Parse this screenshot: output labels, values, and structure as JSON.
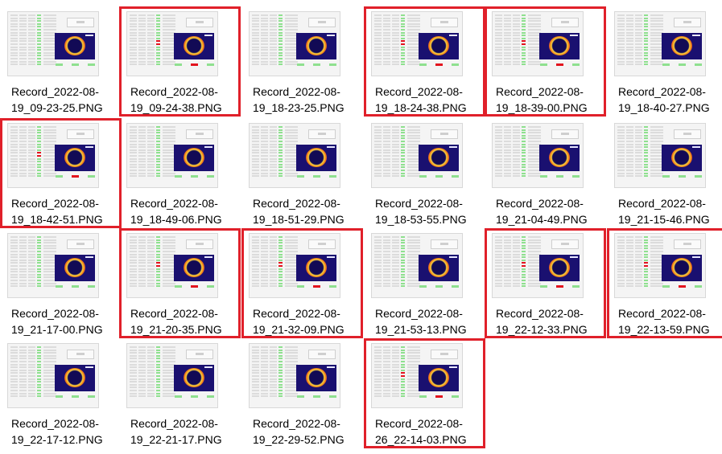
{
  "files": [
    {
      "line1": "Record_2022-08-",
      "line2": "19_09-23-25.PNG",
      "selected": false,
      "alert": false
    },
    {
      "line1": "Record_2022-08-",
      "line2": "19_09-24-38.PNG",
      "selected": true,
      "alert": true
    },
    {
      "line1": "Record_2022-08-",
      "line2": "19_18-23-25.PNG",
      "selected": false,
      "alert": false
    },
    {
      "line1": "Record_2022-08-",
      "line2": "19_18-24-38.PNG",
      "selected": true,
      "alert": true
    },
    {
      "line1": "Record_2022-08-",
      "line2": "19_18-39-00.PNG",
      "selected": true,
      "alert": true
    },
    {
      "line1": "Record_2022-08-",
      "line2": "19_18-40-27.PNG",
      "selected": false,
      "alert": false
    },
    {
      "line1": "Record_2022-08-",
      "line2": "19_18-42-51.PNG",
      "selected": true,
      "alert": true
    },
    {
      "line1": "Record_2022-08-",
      "line2": "19_18-49-06.PNG",
      "selected": false,
      "alert": false
    },
    {
      "line1": "Record_2022-08-",
      "line2": "19_18-51-29.PNG",
      "selected": false,
      "alert": false
    },
    {
      "line1": "Record_2022-08-",
      "line2": "19_18-53-55.PNG",
      "selected": false,
      "alert": false
    },
    {
      "line1": "Record_2022-08-",
      "line2": "19_21-04-49.PNG",
      "selected": false,
      "alert": false
    },
    {
      "line1": "Record_2022-08-",
      "line2": "19_21-15-46.PNG",
      "selected": false,
      "alert": false
    },
    {
      "line1": "Record_2022-08-",
      "line2": "19_21-17-00.PNG",
      "selected": false,
      "alert": false
    },
    {
      "line1": "Record_2022-08-",
      "line2": "19_21-20-35.PNG",
      "selected": true,
      "alert": true
    },
    {
      "line1": "Record_2022-08-",
      "line2": "19_21-32-09.PNG",
      "selected": true,
      "alert": true
    },
    {
      "line1": "Record_2022-08-",
      "line2": "19_21-53-13.PNG",
      "selected": false,
      "alert": false
    },
    {
      "line1": "Record_2022-08-",
      "line2": "19_22-12-33.PNG",
      "selected": true,
      "alert": true
    },
    {
      "line1": "Record_2022-08-",
      "line2": "19_22-13-59.PNG",
      "selected": true,
      "alert": true
    },
    {
      "line1": "Record_2022-08-",
      "line2": "19_22-17-12.PNG",
      "selected": false,
      "alert": false
    },
    {
      "line1": "Record_2022-08-",
      "line2": "19_22-21-17.PNG",
      "selected": false,
      "alert": false
    },
    {
      "line1": "Record_2022-08-",
      "line2": "19_22-29-52.PNG",
      "selected": false,
      "alert": false
    },
    {
      "line1": "Record_2022-08-",
      "line2": "26_22-14-03.PNG",
      "selected": true,
      "alert": true
    }
  ],
  "colors": {
    "selection_border": "#e0202a",
    "ok_indicator": "#8fe08f",
    "alert_indicator": "#e2141e"
  }
}
